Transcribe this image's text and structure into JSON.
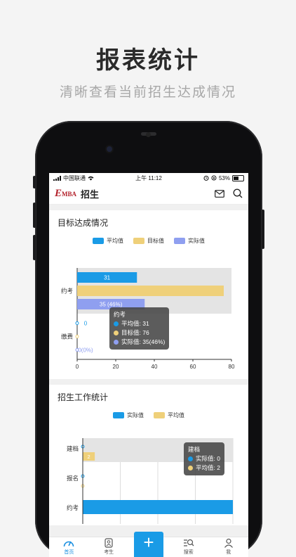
{
  "promo": {
    "title": "报表统计",
    "subtitle": "清晰查看当前招生达成情况"
  },
  "status_bar": {
    "carrier": "中国联通",
    "time": "上午 11:12",
    "battery": "53%",
    "battery_level": 0.53
  },
  "app": {
    "logo_e": "E",
    "logo_mba": "MBA",
    "title": "招生",
    "icons": [
      "mail-icon",
      "search-icon"
    ]
  },
  "colors": {
    "avg": "#1a9be6",
    "target": "#efd07a",
    "actual": "#8f9ff0",
    "accent": "#1a9be6"
  },
  "card1": {
    "title": "目标达成情况",
    "legend": [
      "平均值",
      "目标值",
      "实际值"
    ],
    "tooltip": {
      "title": "约考",
      "rows": [
        "平均值: 31",
        "目标值: 76",
        "实际值: 35(46%)"
      ]
    }
  },
  "card2": {
    "title": "招生工作统计",
    "legend": [
      "实际值",
      "平均值"
    ],
    "tooltip": {
      "title": "建档",
      "rows": [
        "实际值: 0",
        "平均值: 2"
      ]
    }
  },
  "chart_data": [
    {
      "type": "bar",
      "orientation": "horizontal",
      "categories": [
        "约考",
        "缴费"
      ],
      "series": [
        {
          "name": "平均值",
          "values": [
            31,
            0
          ]
        },
        {
          "name": "目标值",
          "values": [
            76,
            0
          ]
        },
        {
          "name": "实际值",
          "values": [
            35,
            0
          ]
        }
      ],
      "data_labels": {
        "约考": [
          "31",
          "",
          "35 (46%)"
        ],
        "缴费": [
          "0",
          "",
          "0(0%)"
        ]
      },
      "xlim": [
        0,
        80
      ],
      "xticks": [
        "0",
        "20",
        "40",
        "60",
        "80"
      ],
      "highlighted_category": "约考",
      "legend": "top-center"
    },
    {
      "type": "bar",
      "orientation": "horizontal",
      "categories": [
        "建档",
        "报名",
        "约考"
      ],
      "visible_category_labels": [
        "建档",
        "报名",
        "约考"
      ],
      "series": [
        {
          "name": "实际值",
          "values": [
            0,
            0,
            null
          ]
        },
        {
          "name": "平均值",
          "values": [
            2,
            0,
            null
          ]
        }
      ],
      "data_labels": {
        "建档": [
          "",
          "2"
        ]
      },
      "highlighted_category": "建档",
      "legend": "top-center"
    }
  ],
  "tabbar": {
    "tabs": [
      {
        "label": "首页",
        "icon": "dashboard-icon",
        "active": true
      },
      {
        "label": "考生",
        "icon": "person-card-icon",
        "active": false
      },
      {
        "label": "",
        "icon": "plus-icon",
        "active": false
      },
      {
        "label": "搜索",
        "icon": "search-list-icon",
        "active": false
      },
      {
        "label": "我",
        "icon": "user-icon",
        "active": false
      }
    ],
    "fab": "+"
  }
}
